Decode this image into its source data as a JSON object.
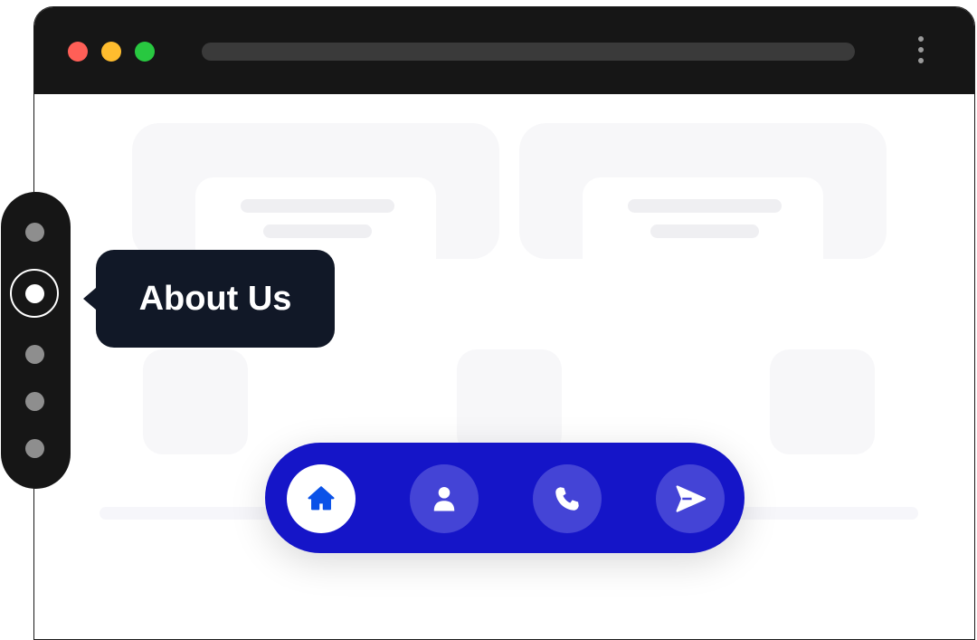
{
  "window": {
    "traffic_lights": {
      "close": "#ff5f57",
      "minimize": "#febc2e",
      "maximize": "#28c840"
    },
    "menu_icon": "kebab-vertical-icon"
  },
  "side_nav": {
    "items": [
      {
        "name": "section-1",
        "active": false
      },
      {
        "name": "about-us",
        "active": true
      },
      {
        "name": "section-3",
        "active": false
      },
      {
        "name": "section-4",
        "active": false
      },
      {
        "name": "section-5",
        "active": false
      }
    ],
    "tooltip": "About Us"
  },
  "dock": {
    "background": "#1515c8",
    "items": [
      {
        "icon": "home-icon",
        "active": true
      },
      {
        "icon": "user-icon",
        "active": false
      },
      {
        "icon": "phone-icon",
        "active": false
      },
      {
        "icon": "send-icon",
        "active": false
      }
    ]
  }
}
